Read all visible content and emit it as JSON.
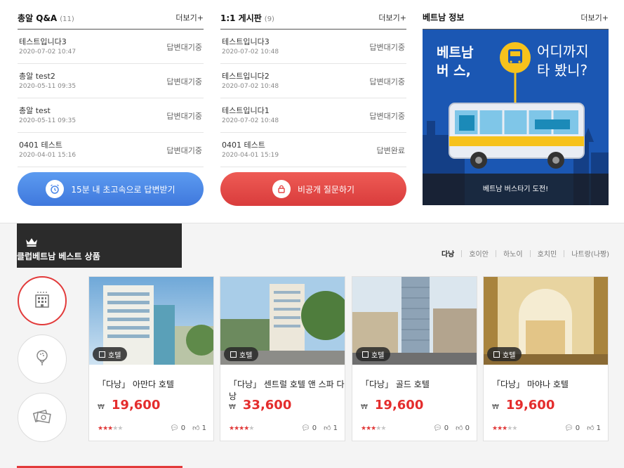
{
  "qna": {
    "title": "총알 Q&A",
    "count": "(11)",
    "more": "더보기+",
    "items": [
      {
        "title": "테스트입니다3",
        "date": "2020-07-02 10:47",
        "status": "답변대기중"
      },
      {
        "title": "총알 test2",
        "date": "2020-05-11 09:35",
        "status": "답변대기중"
      },
      {
        "title": "총알 test",
        "date": "2020-05-11 09:35",
        "status": "답변대기중"
      },
      {
        "title": "0401 테스트",
        "date": "2020-04-01 15:16",
        "status": "답변대기중"
      }
    ],
    "button": "15분 내 초고속으로 답변받기",
    "button_color": "#4a86e8"
  },
  "board": {
    "title": "1:1 게시판",
    "count": "(9)",
    "more": "더보기+",
    "items": [
      {
        "title": "테스트입니다3",
        "date": "2020-07-02 10:48",
        "status": "답변대기중"
      },
      {
        "title": "테스트입니다2",
        "date": "2020-07-02 10:48",
        "status": "답변대기중"
      },
      {
        "title": "테스트입니다1",
        "date": "2020-07-02 10:48",
        "status": "답변대기중"
      },
      {
        "title": "0401 테스트",
        "date": "2020-04-01 15:19",
        "status": "답변완료"
      }
    ],
    "button": "비공개 질문하기",
    "button_color": "#e54646"
  },
  "info": {
    "title": "베트남 정보",
    "more": "더보기+",
    "banner": {
      "headline_left": [
        "베트남",
        "버 스,"
      ],
      "headline_right": [
        "어디까지",
        "타 봤니?"
      ],
      "caption": "베트남 버스타기 도전!"
    }
  },
  "best": {
    "title": "클럽베트남 베스트 상품",
    "cities": [
      "다낭",
      "호이안",
      "하노이",
      "호치민",
      "나트랑(나짱)"
    ],
    "active_city": 0,
    "categories": [
      {
        "icon": "building-icon",
        "active": true
      },
      {
        "icon": "golf-icon",
        "active": false
      },
      {
        "icon": "money-icon",
        "active": false
      }
    ],
    "cards": [
      {
        "badge": "호텔",
        "name": "「다낭」 아만다 호텔",
        "currency": "₩",
        "price": "19,600",
        "rating": 3,
        "comments": "0",
        "likes": "1"
      },
      {
        "badge": "호텔",
        "name": "「다낭」 센트럴 호텔 앤 스파 다낭",
        "currency": "₩",
        "price": "33,600",
        "rating": 4,
        "comments": "0",
        "likes": "1"
      },
      {
        "badge": "호텔",
        "name": "「다낭」 골드 호텔",
        "currency": "₩",
        "price": "19,600",
        "rating": 3,
        "comments": "0",
        "likes": "0"
      },
      {
        "badge": "호텔",
        "name": "「다낭」 마야나 호텔",
        "currency": "₩",
        "price": "19,600",
        "rating": 3,
        "comments": "0",
        "likes": "1"
      }
    ]
  }
}
